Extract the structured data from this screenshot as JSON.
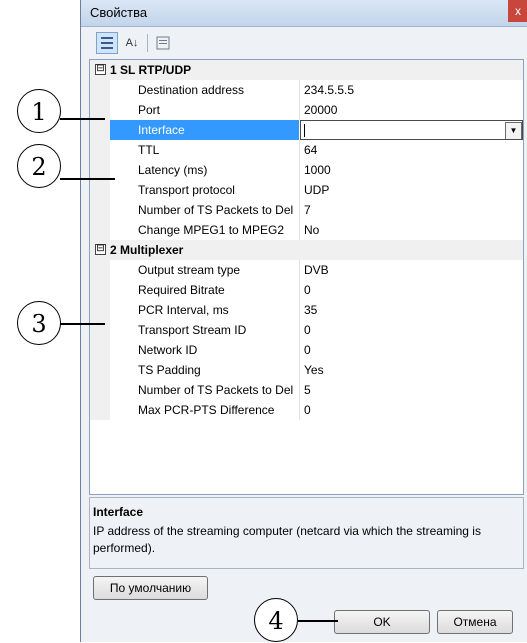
{
  "window": {
    "title": "Свойства",
    "close_glyph": "x"
  },
  "toolbar": {
    "sort_glyph": "A↓"
  },
  "categories": [
    {
      "toggle": "⊟",
      "label": "1 SL RTP/UDP"
    },
    {
      "toggle": "⊟",
      "label": "2 Multiplexer"
    }
  ],
  "properties": [
    {
      "name": "Destination address",
      "value": "234.5.5.5"
    },
    {
      "name": "Port",
      "value": "20000"
    },
    {
      "name": "Interface",
      "value": ""
    },
    {
      "name": "TTL",
      "value": "64"
    },
    {
      "name": "Latency (ms)",
      "value": "1000"
    },
    {
      "name": "Transport protocol",
      "value": "UDP"
    },
    {
      "name": "Number of TS Packets to Del",
      "value": "7"
    },
    {
      "name": "Change MPEG1 to MPEG2",
      "value": "No"
    },
    {
      "name": "Output stream type",
      "value": "DVB"
    },
    {
      "name": "Required Bitrate",
      "value": "0"
    },
    {
      "name": "PCR Interval, ms",
      "value": "35"
    },
    {
      "name": "Transport Stream ID",
      "value": "0"
    },
    {
      "name": "Network ID",
      "value": "0"
    },
    {
      "name": "TS Padding",
      "value": "Yes"
    },
    {
      "name": "Number of TS Packets to Del",
      "value": "5"
    },
    {
      "name": "Max PCR-PTS Difference",
      "value": "0"
    }
  ],
  "description": {
    "title": "Interface",
    "text": "IP address of the streaming computer (netcard via which the streaming is performed)."
  },
  "buttons": {
    "defaults": "По умолчанию",
    "ok": "OK",
    "cancel": "Отмена"
  },
  "callouts": [
    "1",
    "2",
    "3",
    "4"
  ],
  "dropdown_glyph": "▼"
}
